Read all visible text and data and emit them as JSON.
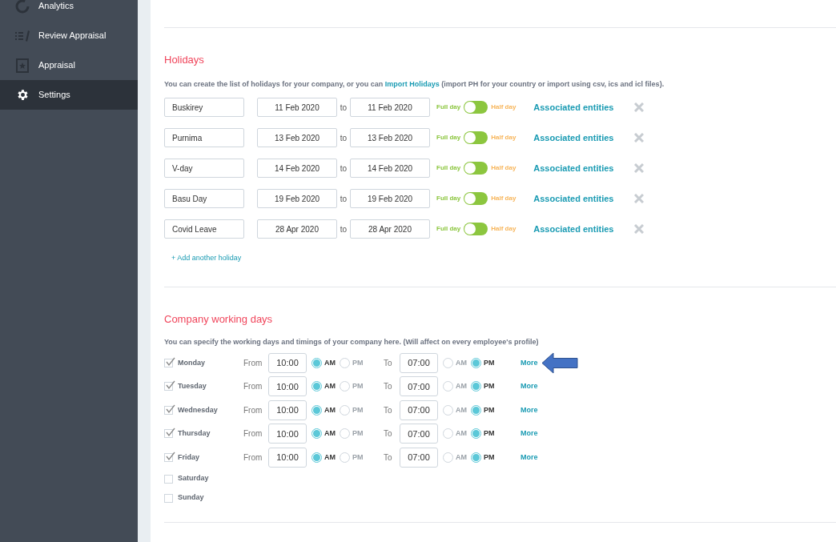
{
  "sidebar": {
    "items": [
      {
        "label": "Analytics",
        "selected": false
      },
      {
        "label": "Review Appraisal",
        "selected": false
      },
      {
        "label": "Appraisal",
        "selected": false
      },
      {
        "label": "Settings",
        "selected": true
      }
    ]
  },
  "holidays": {
    "title": "Holidays",
    "description": "You can create the list of holidays for your company, or you can ",
    "import_link": "Import Holidays",
    "description_end": " (import PH for your country or import using csv, ics and icl files).",
    "rows": [
      {
        "name": "Buskirey",
        "from": "11 Feb 2020",
        "to_label": "to",
        "to": "11 Feb 2020",
        "full_label": "Full day",
        "half_day": false,
        "half_label": "Half day",
        "entities": "Associated entities"
      },
      {
        "name": "Purnima",
        "from": "13 Feb 2020",
        "to_label": "to",
        "to": "13 Feb 2020",
        "full_label": "Full day",
        "half_day": false,
        "half_label": "Half day",
        "entities": "Associated entities"
      },
      {
        "name": "V-day",
        "from": "14 Feb 2020",
        "to_label": "to",
        "to": "14 Feb 2020",
        "full_label": "Full day",
        "half_day": false,
        "half_label": "Half day",
        "entities": "Associated entities"
      },
      {
        "name": "Basu Day",
        "from": "19 Feb 2020",
        "to_label": "to",
        "to": "19 Feb 2020",
        "full_label": "Full day",
        "half_day": false,
        "half_label": "Half day",
        "entities": "Associated entities"
      },
      {
        "name": "Covid Leave",
        "from": "28 Apr 2020",
        "to_label": "to",
        "to": "28 Apr 2020",
        "full_label": "Full day",
        "half_day": false,
        "half_label": "Half day",
        "entities": "Associated entities"
      }
    ],
    "add_link": "+ Add another holiday"
  },
  "working_days": {
    "title": "Company working days",
    "description": "You can specify the working days and timings of your company here. (Will affect on every employee's profile)",
    "days": [
      {
        "day": "Monday",
        "checked": true,
        "from_label": "From",
        "from": {
          "time": "10:00",
          "options": [
            {
              "label": "AM",
              "selected": true
            },
            {
              "label": "PM",
              "selected": false
            }
          ]
        },
        "to_label": "To",
        "to": {
          "time": "07:00",
          "options": [
            {
              "label": "AM",
              "selected": false
            },
            {
              "label": "PM",
              "selected": true
            }
          ]
        },
        "more": "More",
        "annotated": true
      },
      {
        "day": "Tuesday",
        "checked": true,
        "from_label": "From",
        "from": {
          "time": "10:00",
          "options": [
            {
              "label": "AM",
              "selected": true
            },
            {
              "label": "PM",
              "selected": false
            }
          ]
        },
        "to_label": "To",
        "to": {
          "time": "07:00",
          "options": [
            {
              "label": "AM",
              "selected": false
            },
            {
              "label": "PM",
              "selected": true
            }
          ]
        },
        "more": "More",
        "annotated": false
      },
      {
        "day": "Wednesday",
        "checked": true,
        "from_label": "From",
        "from": {
          "time": "10:00",
          "options": [
            {
              "label": "AM",
              "selected": true
            },
            {
              "label": "PM",
              "selected": false
            }
          ]
        },
        "to_label": "To",
        "to": {
          "time": "07:00",
          "options": [
            {
              "label": "AM",
              "selected": false
            },
            {
              "label": "PM",
              "selected": true
            }
          ]
        },
        "more": "More",
        "annotated": false
      },
      {
        "day": "Thursday",
        "checked": true,
        "from_label": "From",
        "from": {
          "time": "10:00",
          "options": [
            {
              "label": "AM",
              "selected": true
            },
            {
              "label": "PM",
              "selected": false
            }
          ]
        },
        "to_label": "To",
        "to": {
          "time": "07:00",
          "options": [
            {
              "label": "AM",
              "selected": false
            },
            {
              "label": "PM",
              "selected": true
            }
          ]
        },
        "more": "More",
        "annotated": false
      },
      {
        "day": "Friday",
        "checked": true,
        "from_label": "From",
        "from": {
          "time": "10:00",
          "options": [
            {
              "label": "AM",
              "selected": true
            },
            {
              "label": "PM",
              "selected": false
            }
          ]
        },
        "to_label": "To",
        "to": {
          "time": "07:00",
          "options": [
            {
              "label": "AM",
              "selected": false
            },
            {
              "label": "PM",
              "selected": true
            }
          ]
        },
        "more": "More",
        "annotated": false
      },
      {
        "day": "Saturday",
        "checked": false
      },
      {
        "day": "Sunday",
        "checked": false
      }
    ]
  }
}
